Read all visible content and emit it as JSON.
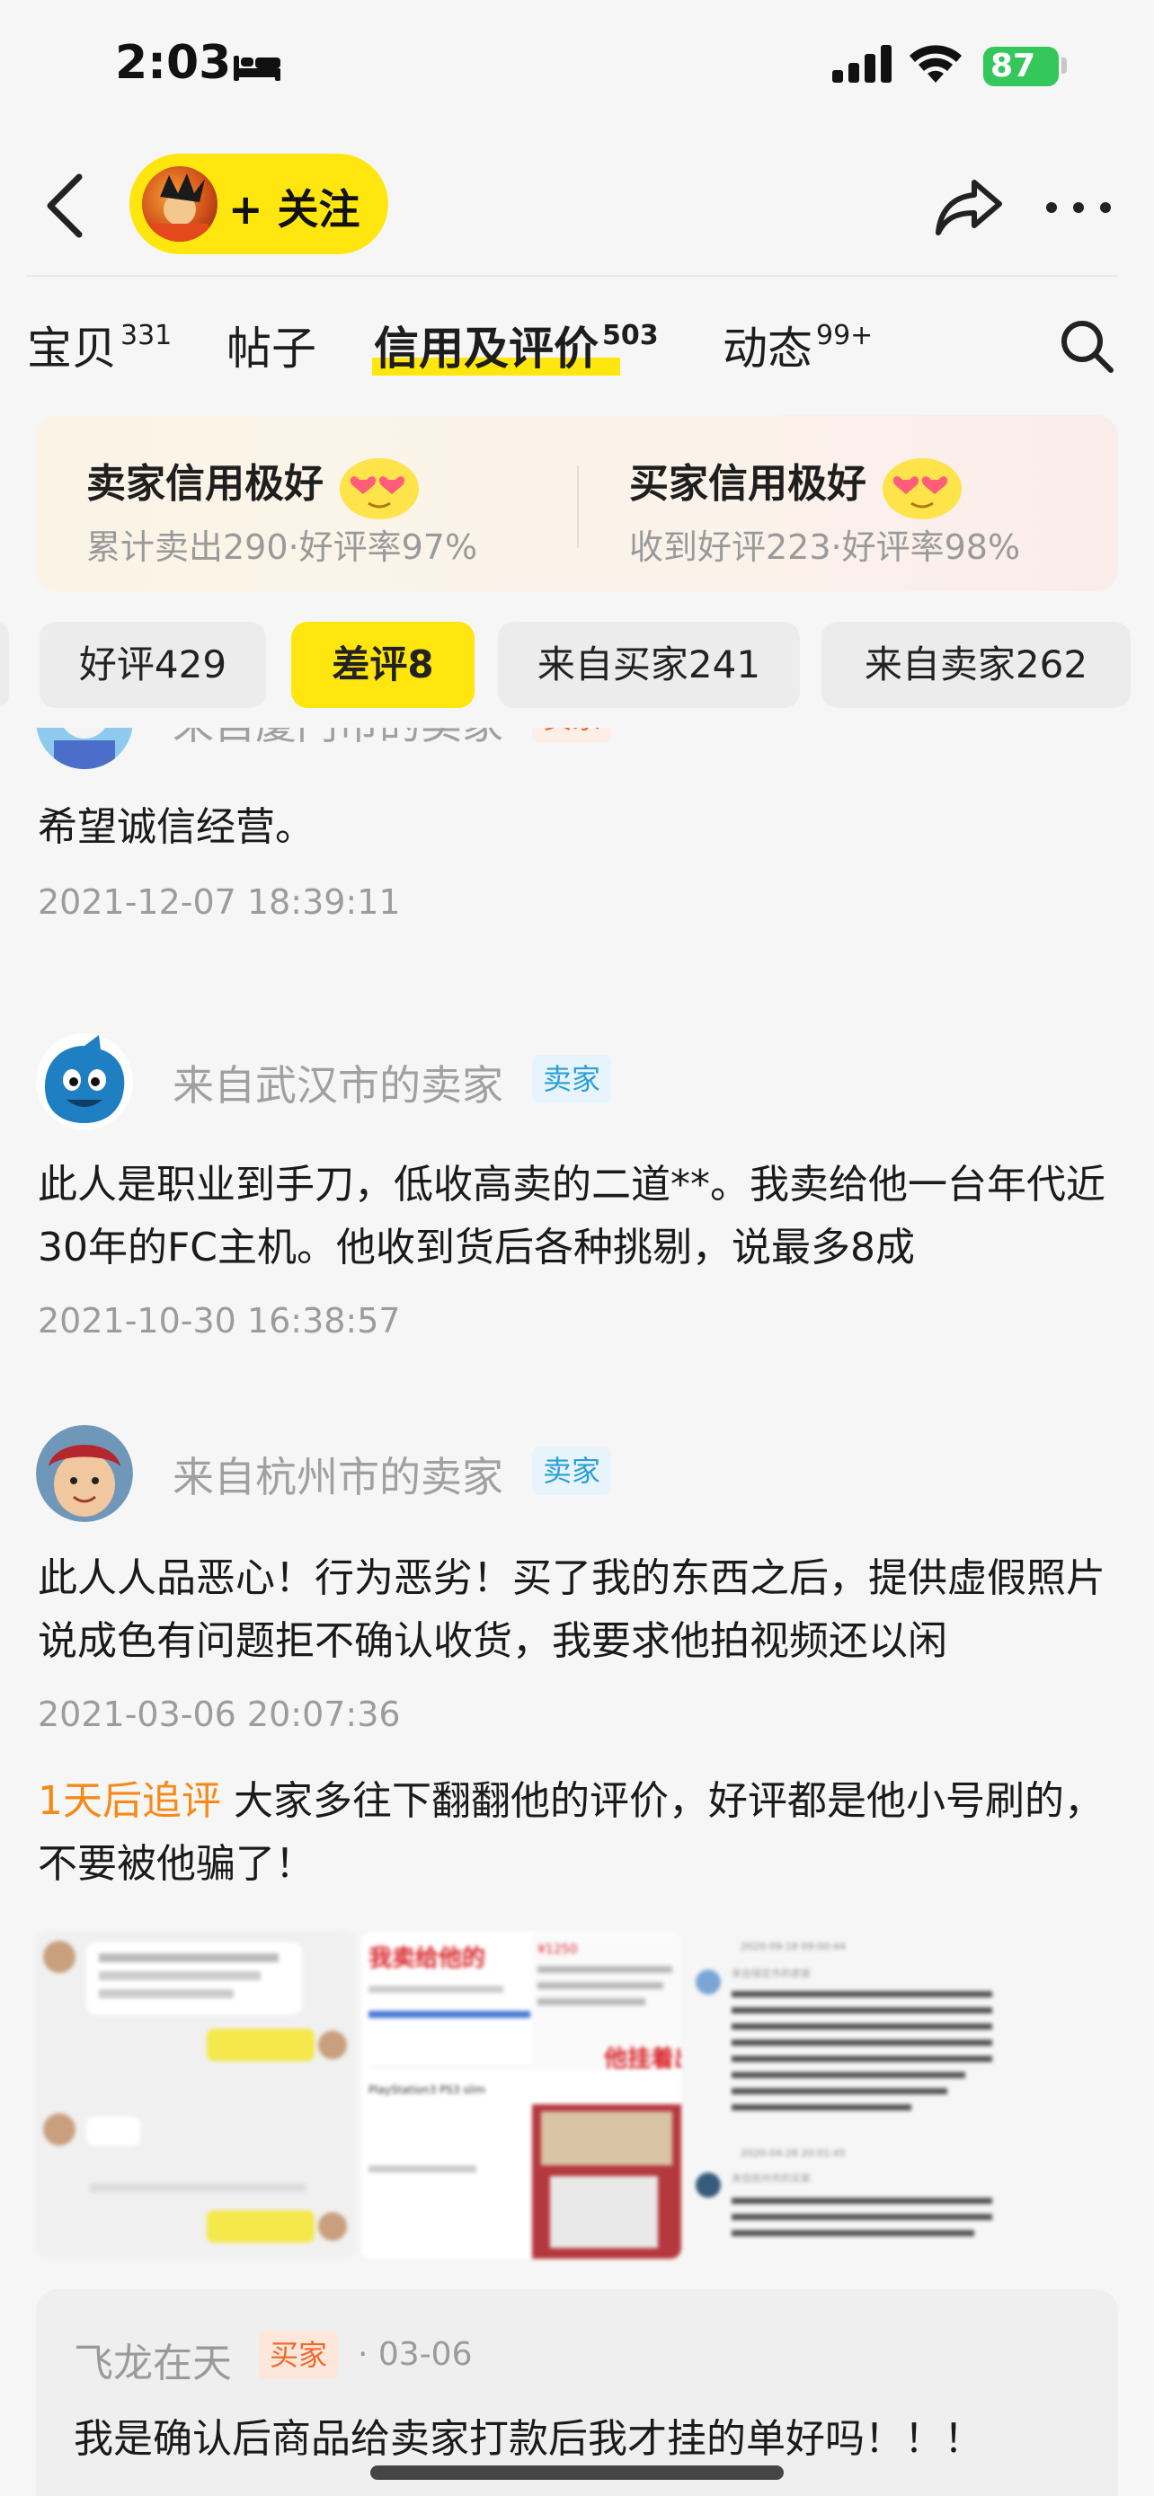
{
  "status_bar": {
    "time": "2:03",
    "battery": "87"
  },
  "nav": {
    "follow_label": "+ 关注"
  },
  "tabs": [
    {
      "label": "宝贝",
      "count": "331"
    },
    {
      "label": "帖子",
      "count": ""
    },
    {
      "label": "信用及评价",
      "count": "503"
    },
    {
      "label": "动态",
      "count": "99+"
    }
  ],
  "credit": {
    "seller": {
      "title": "卖家信用极好",
      "sub": "累计卖出290·好评率97%"
    },
    "buyer": {
      "title": "买家信用极好",
      "sub": "收到好评223·好评率98%"
    }
  },
  "filters": [
    {
      "label": "好评429",
      "active": false
    },
    {
      "label": "差评8",
      "active": true
    },
    {
      "label": "来自买家241",
      "active": false
    },
    {
      "label": "来自卖家262",
      "active": false
    }
  ],
  "reviews": [
    {
      "from": "来自厦门市的卖家",
      "badge": "卖家",
      "text": "希望诚信经营。",
      "time": "2021-12-07 18:39:11"
    },
    {
      "from": "来自武汉市的卖家",
      "badge": "卖家",
      "text": "此人是职业到手刀，低收高卖的二道**。我卖给他一台年代近30年的FC主机。他收到货后各种挑剔，说最多8成",
      "time": "2021-10-30 16:38:57"
    },
    {
      "from": "来自杭州市的卖家",
      "badge": "卖家",
      "text": "此人人品恶心！行为恶劣！买了我的东西之后，提供虚假照片说成色有问题拒不确认收货，我要求他拍视频还以闲",
      "time": "2021-03-06 20:07:36",
      "followup_tag": "1天后追评",
      "followup_text": " 大家多往下翻翻他的评价，好评都是他小号刷的，不要被他骗了！"
    }
  ],
  "photos": {
    "p2_title": "我卖给他的",
    "p2_item": "PlayStation3  PS3 slim",
    "p2_price": "¥1250",
    "p2_tag": "他挂着出",
    "p3_date1": "2020-09-18 09:00:44",
    "p3_from1": "来自保定市的卖家",
    "p3_date2": "2020-04-28 20:01:45",
    "p3_from2": "来自抚州市的买家"
  },
  "reply": {
    "name": "飞龙在天",
    "badge": "买家",
    "date": "· 03-06",
    "text": "我是确认后商品给卖家打款后我才挂的单好吗！！！"
  },
  "colors": {
    "accent_yellow": "#ffe60f",
    "seller_badge": "#2aa0d6",
    "buyer_badge": "#ef6a2a",
    "followup_orange": "#f58a18",
    "battery_green": "#34c759"
  }
}
